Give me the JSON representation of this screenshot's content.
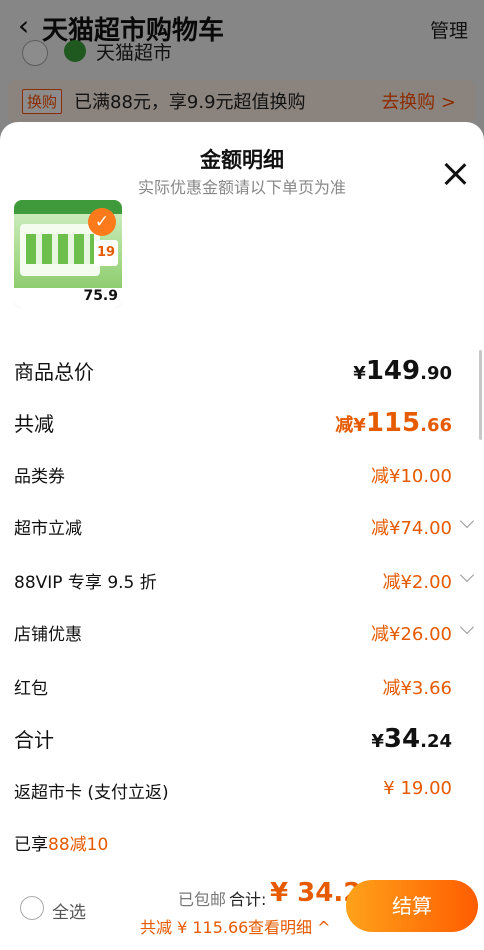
{
  "background": {
    "back_icon": "chevron-left-icon",
    "title": "天猫超市购物车",
    "manage": "管理",
    "store_name": "天猫超市",
    "promo_tag": "换购",
    "promo_text": "已满88元，享9.9元超值换购",
    "promo_link": "去换购 >"
  },
  "sheet": {
    "title": "金额明细",
    "subtitle": "实际优惠金额请以下单页为准",
    "close_icon": "close-icon",
    "thumb_price": "75.9",
    "thumb_badge": "19",
    "rows": {
      "goods_total": {
        "label": "商品总价",
        "symbol": "¥",
        "int": "149",
        "dec": ".90"
      },
      "total_reduce": {
        "label": "共减",
        "prefix": "减",
        "symbol": "¥",
        "int": "115",
        "dec": ".66"
      },
      "category_coupon": {
        "label": "品类券",
        "value": "减¥10.00"
      },
      "supermarket_discount": {
        "label": "超市立减",
        "value": "减¥74.00"
      },
      "vip_discount": {
        "label": "88VIP 专享 9.5 折",
        "value": "减¥2.00"
      },
      "store_discount": {
        "label": "店铺优惠",
        "value": "减¥26.00"
      },
      "red_packet": {
        "label": "红包",
        "value": "减¥3.66"
      },
      "subtotal": {
        "label": "合计",
        "symbol": "¥",
        "int": "34",
        "dec": ".24"
      },
      "card_refund": {
        "label": "返超市卡 (支付立返)",
        "value": "¥ 19.00"
      },
      "enjoyed": {
        "label": "已享",
        "value": "88减10"
      }
    }
  },
  "bottom_bar": {
    "select_all": "全选",
    "shipping": "已包邮",
    "total_label": "合计:",
    "total_value": "¥ 34.24",
    "saved": "共减 ¥ 115.66",
    "detail_link": "查看明细 ^",
    "checkout": "结算"
  },
  "colors": {
    "accent": "#e65a00",
    "button_start": "#ffa21a",
    "button_end": "#ff5d00"
  }
}
